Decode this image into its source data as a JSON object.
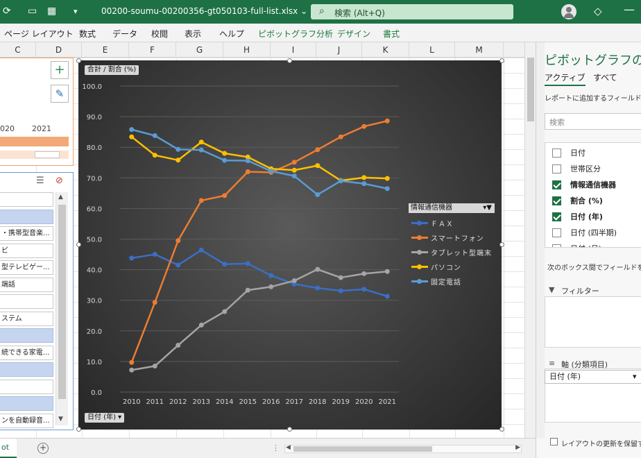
{
  "titlebar": {
    "filename": "00200-soumu-00200356-gt050103-full-list.xlsx",
    "filename_arrow": "⌄",
    "search_placeholder": "検索 (Alt+Q)"
  },
  "ribbon": {
    "tabs": [
      "ページ レイアウト",
      "数式",
      "データ",
      "校閲",
      "表示",
      "ヘルプ",
      "ピボットグラフ分析",
      "デザイン",
      "書式"
    ]
  },
  "columns": [
    "C",
    "D",
    "E",
    "F",
    "G",
    "H",
    "I",
    "J",
    "K",
    "L",
    "M"
  ],
  "timeline": {
    "years": [
      "020",
      "2021"
    ]
  },
  "slicer": {
    "items": [
      {
        "label": "",
        "selected": false
      },
      {
        "label": "",
        "selected": true
      },
      {
        "label": "・携帯型音楽...",
        "selected": false
      },
      {
        "label": "ビ",
        "selected": false
      },
      {
        "label": "型テレビゲー...",
        "selected": false
      },
      {
        "label": "端話",
        "selected": false
      },
      {
        "label": "",
        "selected": false
      },
      {
        "label": "ステム",
        "selected": false
      },
      {
        "label": "",
        "selected": true
      },
      {
        "label": "続できる家電...",
        "selected": false
      },
      {
        "label": "",
        "selected": true
      },
      {
        "label": "",
        "selected": false
      },
      {
        "label": "",
        "selected": true
      },
      {
        "label": "ンを自動録音...",
        "selected": false
      }
    ]
  },
  "chart": {
    "value_field_button": "合計 / 割合 (%)",
    "axis_field_button": "日付 (年)",
    "legend_field_button": "情報通信機器"
  },
  "chart_data": {
    "type": "line",
    "x": [
      2010,
      2011,
      2012,
      2013,
      2014,
      2015,
      2016,
      2017,
      2018,
      2019,
      2020,
      2021
    ],
    "ylim": [
      0,
      100
    ],
    "yticks": [
      "0.0",
      "10.0",
      "20.0",
      "30.0",
      "40.0",
      "50.0",
      "60.0",
      "70.0",
      "80.0",
      "90.0",
      "100.0"
    ],
    "legend_position": "right",
    "grid": true,
    "series": [
      {
        "name": "ＦＡＸ",
        "color": "#3a6fc4",
        "values": [
          43.8,
          45.0,
          41.5,
          46.4,
          41.8,
          42.0,
          38.1,
          35.3,
          34.0,
          33.1,
          33.6,
          31.3
        ]
      },
      {
        "name": "スマートフォン",
        "color": "#ed7d31",
        "values": [
          9.7,
          29.3,
          49.5,
          62.6,
          64.2,
          72.0,
          71.8,
          75.1,
          79.2,
          83.4,
          86.8,
          88.6
        ]
      },
      {
        "name": "タブレット型端末",
        "color": "#a5a5a5",
        "values": [
          7.2,
          8.5,
          15.3,
          21.9,
          26.3,
          33.3,
          34.4,
          36.4,
          40.1,
          37.4,
          38.7,
          39.4
        ]
      },
      {
        "name": "パソコン",
        "color": "#ffc000",
        "values": [
          83.4,
          77.4,
          75.8,
          81.7,
          78.0,
          76.8,
          73.0,
          72.5,
          74.0,
          69.1,
          70.1,
          69.8
        ]
      },
      {
        "name": "固定電話",
        "color": "#5b9bd5",
        "values": [
          85.8,
          83.8,
          79.3,
          79.1,
          75.7,
          75.6,
          72.2,
          70.6,
          64.5,
          69.0,
          68.1,
          66.5
        ]
      }
    ]
  },
  "panel": {
    "title": "ピボットグラフのフィ",
    "tab_active": "アクティブ",
    "tab_all": "すべて",
    "instruction": "レポートに追加するフィールドを選",
    "search_placeholder": "検索",
    "fields": [
      {
        "label": "日付",
        "checked": false
      },
      {
        "label": "世帯区分",
        "checked": false
      },
      {
        "label": "情報通信機器",
        "checked": true
      },
      {
        "label": "割合 (%)",
        "checked": true
      },
      {
        "label": "日付 (年)",
        "checked": true
      },
      {
        "label": "日付 (四半期)",
        "checked": false
      },
      {
        "label": "日付 (月)",
        "checked": false
      }
    ],
    "drag_note": "次のボックス間でフィールドをドラ",
    "filter_label": "フィルター",
    "axis_label": "軸 (分類項目)",
    "axis_item": "日付 (年)",
    "axis_item_arrow": "▾",
    "defer_label": "レイアウトの更新を保留す"
  },
  "sheetbar": {
    "sheet_name": "ot"
  }
}
